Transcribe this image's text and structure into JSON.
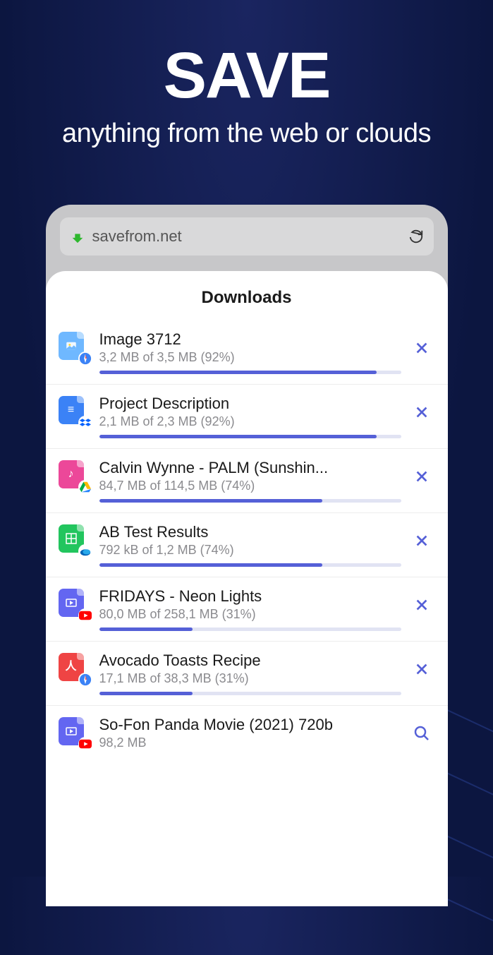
{
  "hero": {
    "title": "SAVE",
    "subtitle": "anything from the web or clouds"
  },
  "browser": {
    "url": "savefrom.net"
  },
  "panel": {
    "title": "Downloads"
  },
  "downloads": [
    {
      "title": "Image 3712",
      "status": "3,2 MB of 3,5 MB (92%)",
      "progress": 92,
      "icon_color": "#6fb8ff",
      "icon_glyph": "image",
      "source_badge": "safari",
      "action": "cancel"
    },
    {
      "title": "Project Description",
      "status": "2,1 MB of 2,3 MB (92%)",
      "progress": 92,
      "icon_color": "#3b82f6",
      "icon_glyph": "doc",
      "source_badge": "dropbox",
      "action": "cancel"
    },
    {
      "title": "Calvin Wynne - PALM (Sunshin...",
      "status": "84,7 MB of 114,5 MB (74%)",
      "progress": 74,
      "icon_color": "#ec4899",
      "icon_glyph": "music",
      "source_badge": "gdrive",
      "action": "cancel"
    },
    {
      "title": "AB Test Results",
      "status": "792 kB of 1,2 MB (74%)",
      "progress": 74,
      "icon_color": "#22c55e",
      "icon_glyph": "sheet",
      "source_badge": "onedrive",
      "action": "cancel"
    },
    {
      "title": "FRIDAYS - Neon Lights",
      "status": "80,0 MB of 258,1 MB (31%)",
      "progress": 31,
      "icon_color": "#6366f1",
      "icon_glyph": "video",
      "source_badge": "youtube",
      "action": "cancel"
    },
    {
      "title": "Avocado Toasts Recipe",
      "status": "17,1 MB of 38,3 MB (31%)",
      "progress": 31,
      "icon_color": "#ef4444",
      "icon_glyph": "pdf",
      "source_badge": "safari",
      "action": "cancel"
    },
    {
      "title": "So-Fon Panda Movie (2021) 720b",
      "status": "98,2 MB",
      "progress": null,
      "icon_color": "#6366f1",
      "icon_glyph": "video",
      "source_badge": "youtube",
      "action": "search"
    }
  ]
}
